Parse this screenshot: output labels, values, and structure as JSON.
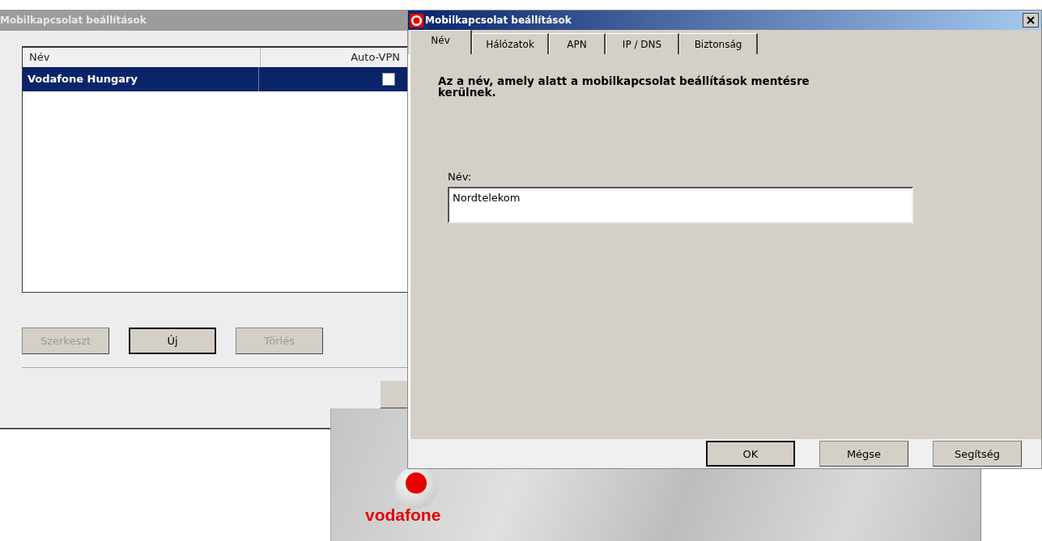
{
  "back_window": {
    "title": "Mobilkapcsolat beállítások",
    "list": {
      "columns": [
        "Név",
        "Auto-VPN"
      ],
      "rows": [
        {
          "name": "Vodafone Hungary",
          "auto_vpn": false,
          "selected": true
        }
      ]
    },
    "buttons": [
      {
        "label": "Szerkeszt",
        "disabled": true,
        "default": false
      },
      {
        "label": "Új",
        "disabled": false,
        "default": true
      },
      {
        "label": "Törlés",
        "disabled": true,
        "default": false
      }
    ]
  },
  "splash": {
    "logo_text": "vodafone"
  },
  "dialog": {
    "title": "Mobilkapcsolat beállítások",
    "tabs": [
      {
        "label": "Név",
        "selected": true
      },
      {
        "label": "Hálózatok",
        "selected": false
      },
      {
        "label": "APN",
        "selected": false
      },
      {
        "label": "IP / DNS",
        "selected": false
      },
      {
        "label": "Biztonság",
        "selected": false
      }
    ],
    "description": "Az a név, amely alatt a mobilkapcsolat beállítások mentésre kerülnek.",
    "name_field": {
      "label": "Név:",
      "value": "Nordtelekom"
    },
    "buttons": [
      {
        "label": "OK",
        "default": true
      },
      {
        "label": "Mégse",
        "default": false
      },
      {
        "label": "Segítség",
        "default": false
      }
    ]
  }
}
